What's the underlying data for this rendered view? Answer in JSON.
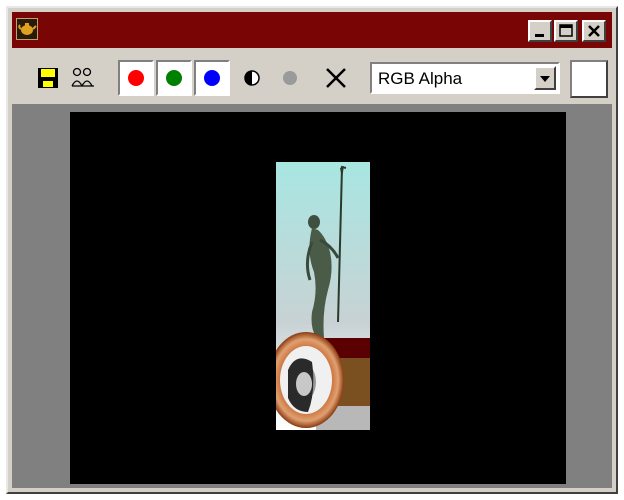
{
  "window": {
    "title": "",
    "buttons": [
      "minimize",
      "maximize",
      "close"
    ]
  },
  "toolbar": {
    "save_icon": "save-icon",
    "clone_icon": "clone-icon",
    "channels": [
      {
        "name": "red",
        "color": "#ff0000",
        "enabled": true
      },
      {
        "name": "green",
        "color": "#008000",
        "enabled": true
      },
      {
        "name": "blue",
        "color": "#0000ff",
        "enabled": true
      }
    ],
    "mono_icon": "half-circle-icon",
    "alpha_icon": "gray-dot-icon",
    "clear_icon": "x-icon",
    "channel_select": {
      "selected": "RGB Alpha"
    },
    "swatch_color": "#ffffff"
  },
  "viewport": {
    "background": "#808080",
    "canvas_background": "#000000"
  }
}
